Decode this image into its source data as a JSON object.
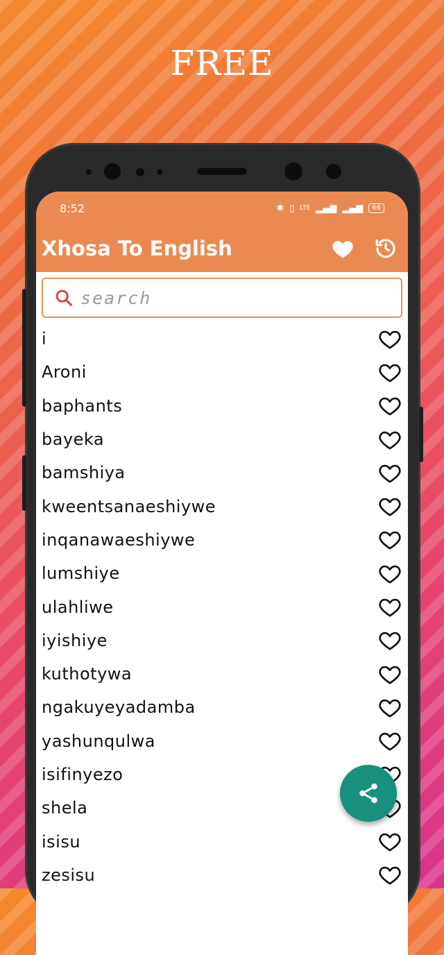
{
  "promo": {
    "title": "FREE"
  },
  "status_bar": {
    "time": "8:52",
    "battery": "66"
  },
  "app_bar": {
    "title": "Xhosa To English",
    "favorites_icon": "heart-filled-icon",
    "history_icon": "history-icon"
  },
  "search": {
    "placeholder": "search",
    "value": ""
  },
  "words": [
    "i",
    "Aroni",
    "baphants",
    "bayeka",
    "bamshiya",
    "kweentsanaeshiywe",
    "inqanawaeshiywe",
    "lumshiye",
    "ulahliwe",
    "iyishiye",
    "kuthotywa",
    "ngakuyeyadamba",
    "yashunqulwa",
    "isifinyezo",
    "shela",
    "isisu",
    "zesisu"
  ],
  "fab": {
    "icon": "share-icon"
  },
  "colors": {
    "accent": "#ea8a52",
    "fab": "#17917e",
    "search_border": "#e8925e"
  }
}
